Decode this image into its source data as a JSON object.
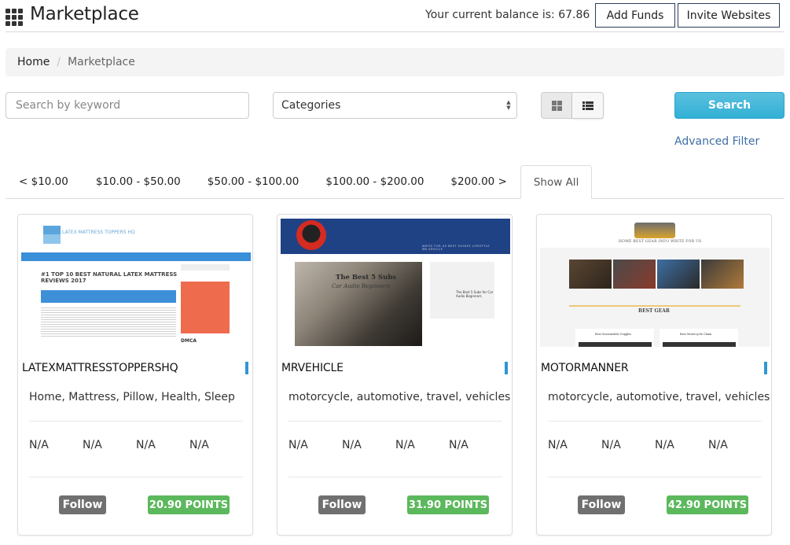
{
  "header": {
    "title": "Marketplace",
    "app_icon": "grid-apps-icon",
    "balance_text": "Your current balance is: 67.86",
    "add_funds_label": "Add Funds",
    "invite_websites_label": "Invite Websites"
  },
  "breadcrumb": {
    "items": [
      "Home",
      "Marketplace"
    ],
    "separator": "/"
  },
  "search": {
    "keyword_placeholder": "Search by keyword",
    "keyword_value": "",
    "category_selected": "Categories",
    "grid_view_icon": "th-large-icon",
    "list_view_icon": "th-list-icon",
    "search_button_label": "Search",
    "advanced_filter_label": "Advanced Filter"
  },
  "price_tabs": [
    {
      "label": "< $10.00",
      "active": false
    },
    {
      "label": "$10.00 - $50.00",
      "active": false
    },
    {
      "label": "$50.00 - $100.00",
      "active": false
    },
    {
      "label": "$100.00 - $200.00",
      "active": false
    },
    {
      "label": "$200.00 >",
      "active": false
    },
    {
      "label": "Show All",
      "active": true
    }
  ],
  "cards": [
    {
      "name": "LATEXMATTRESSTOPPERSHQ",
      "categories": "Home, Mattress, Pillow, Health, Sleep",
      "metrics": [
        "N/A",
        "N/A",
        "N/A",
        "N/A"
      ],
      "follow_label": "Follow",
      "points": "20.90 POINTS",
      "thumb": {
        "logo_text": "LATEX MATTRESS TOPPERS HQ",
        "headline": "#1 TOP 10 BEST NATURAL LATEX MATTRESS REVIEWS 2017",
        "side_heading": "DMCA"
      }
    },
    {
      "name": "MRVEHICLE",
      "categories": "motorcycle, automotive, travel, vehicles",
      "metrics": [
        "N/A",
        "N/A",
        "N/A",
        "N/A"
      ],
      "follow_label": "Follow",
      "points": "31.90 POINTS",
      "thumb": {
        "nav_text": "WRITE FOR US   BEST GUIDES   LIFESTYLE   MR.VEHICLE",
        "image_title": "The Best 5 Subs",
        "image_subtitle": "Car Audio Beginners",
        "side_text": "The Best 5 Subs for Car Audio Beginners"
      }
    },
    {
      "name": "MOTORMANNER",
      "categories": "motorcycle, automotive, travel, vehicles",
      "metrics": [
        "N/A",
        "N/A",
        "N/A",
        "N/A"
      ],
      "follow_label": "Follow",
      "points": "42.90 POINTS",
      "thumb": {
        "nav_text": "HOME   BEST GEAR   INFO   WRITE FOR US",
        "section_title": "BEST GEAR",
        "caption_1": "Best Snowmobile Goggles",
        "caption_2": "Best Motorcycle Chain"
      }
    }
  ],
  "colors": {
    "search_button": "#31b0d5",
    "points_badge": "#5cb85c",
    "follow_button": "#707070",
    "link": "#3d6fa6",
    "card_accent_bar": "#3196d3"
  }
}
